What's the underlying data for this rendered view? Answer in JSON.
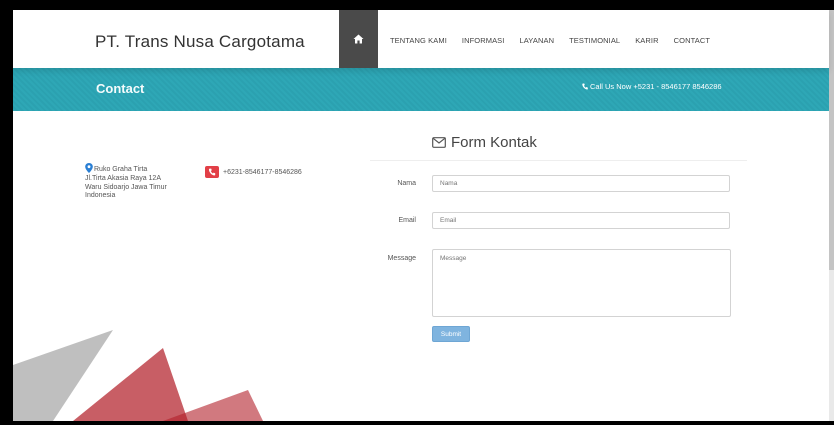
{
  "header": {
    "brand": "PT. Trans Nusa Cargotama",
    "home_icon": "home-icon",
    "nav": [
      "TENTANG KAMI",
      "INFORMASI",
      "LAYANAN",
      "TESTIMONIAL",
      "KARIR",
      "CONTACT"
    ]
  },
  "banner": {
    "title": "Contact",
    "call_text": "Call Us Now +5231 - 8546177 8546286",
    "call_icon": "phone-icon"
  },
  "address": {
    "icon": "map-pin-icon",
    "lines": [
      "Ruko Graha Tirta",
      "Jl.Tirta Akasia Raya 12A",
      "Waru Sidoarjo Jawa Timur",
      "Indonesia"
    ]
  },
  "phone": {
    "icon": "phone-icon",
    "text": "+6231-8546177-8546286"
  },
  "form": {
    "title": "Form Kontak",
    "title_icon": "envelope-icon",
    "nama_label": "Nama",
    "nama_placeholder": "Nama",
    "email_label": "Email",
    "email_placeholder": "Email",
    "message_label": "Message",
    "message_placeholder": "Message",
    "submit_label": "Submit"
  },
  "colors": {
    "banner": "#2ea7b6",
    "home_button": "#4a4a4a",
    "submit": "#7fb4df",
    "phone_badge": "#e23f47",
    "watermark_red": "#b3202a",
    "watermark_gray": "#8a8a8a"
  }
}
